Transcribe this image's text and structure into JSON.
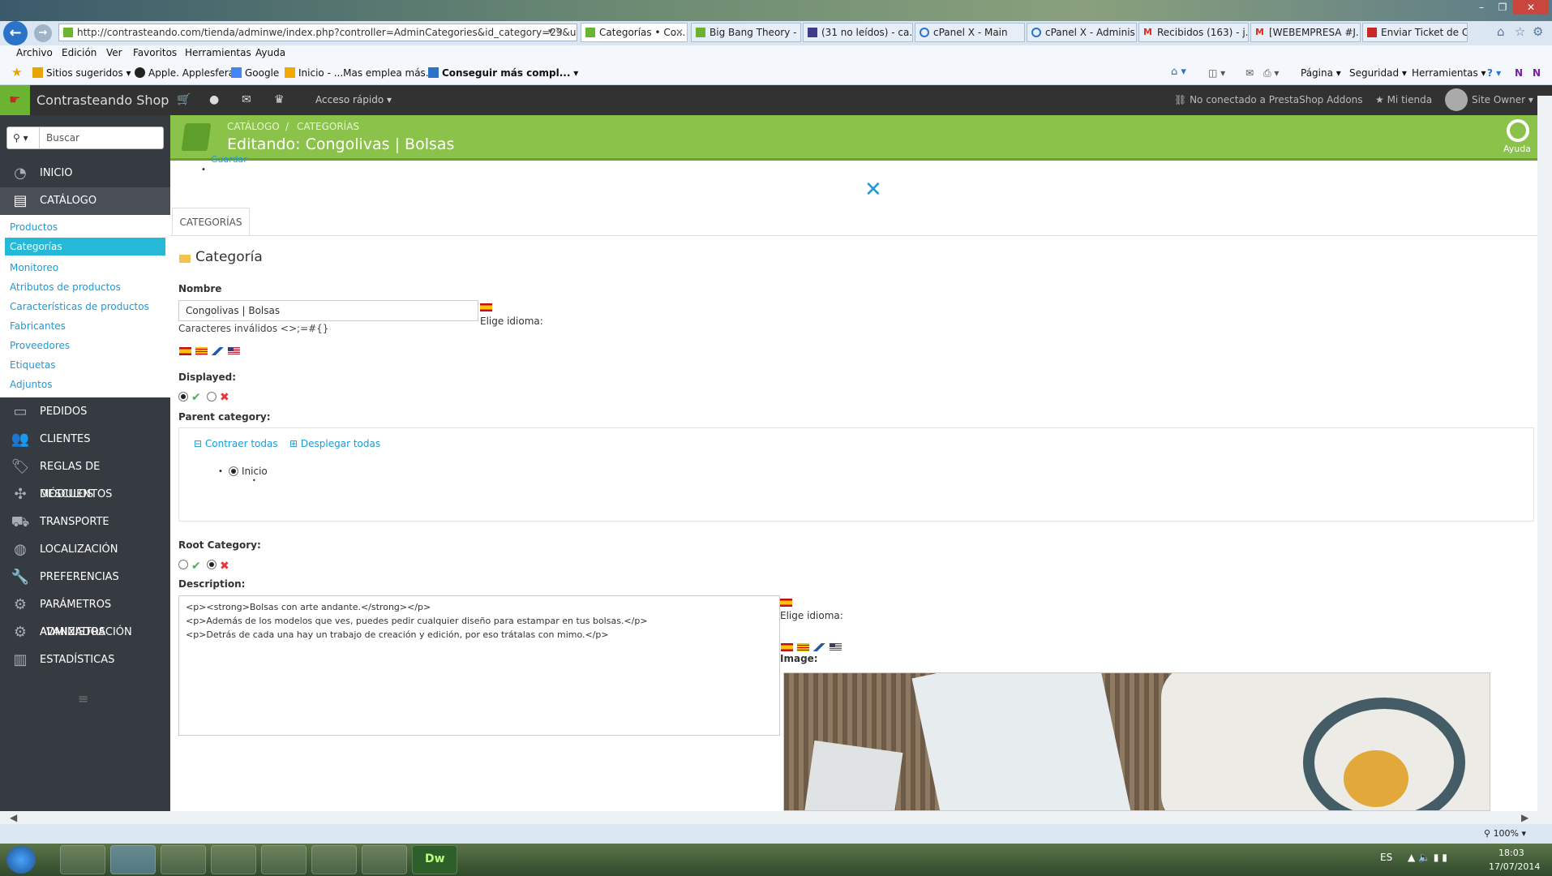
{
  "browser": {
    "url": "http://contrasteando.com/tienda/adminwe/index.php?controller=AdminCategories&id_category=23&updat",
    "tabs": [
      {
        "label": "Categorías • Co...",
        "active": true
      },
      {
        "label": "Big Bang Theory - ...",
        "active": false
      },
      {
        "label": "(31 no leídos) - ca...",
        "active": false
      },
      {
        "label": "cPanel X - Main",
        "active": false
      },
      {
        "label": "cPanel X - Adminis...",
        "active": false
      },
      {
        "label": "Recibidos (163) - j...",
        "active": false
      },
      {
        "label": "[WEBEMPRESA #J...",
        "active": false
      },
      {
        "label": "Enviar Ticket de C...",
        "active": false
      }
    ],
    "menu": [
      "Archivo",
      "Edición",
      "Ver",
      "Favoritos",
      "Herramientas",
      "Ayuda"
    ],
    "favorites": [
      "Sitios sugeridos ▾",
      "Apple. Applesfera",
      "Google",
      "Inicio - ...Mas emplea más...",
      "Conseguir más compl..."
    ],
    "right_tools": [
      "Página ▾",
      "Seguridad ▾",
      "Herramientas ▾"
    ],
    "zoom": "100%"
  },
  "header": {
    "shop_name": "Contrasteando Shop",
    "quick_access": "Acceso rápido",
    "addons": "No conectado a PrestaShop Addons",
    "my_shop": "Mi tienda",
    "user": "Site Owner"
  },
  "sidebar": {
    "search_placeholder": "Buscar",
    "items": [
      {
        "label": "INICIO",
        "icon": "dashboard-icon"
      },
      {
        "label": "CATÁLOGO",
        "icon": "book-icon"
      },
      {
        "label": "PEDIDOS",
        "icon": "credit-card-icon"
      },
      {
        "label": "CLIENTES",
        "icon": "users-icon"
      },
      {
        "label": "REGLAS DE DESCUENTOS",
        "icon": "tags-icon"
      },
      {
        "label": "MÓDULOS",
        "icon": "puzzle-icon"
      },
      {
        "label": "TRANSPORTE",
        "icon": "truck-icon"
      },
      {
        "label": "LOCALIZACIÓN",
        "icon": "globe-icon"
      },
      {
        "label": "PREFERENCIAS",
        "icon": "wrench-icon"
      },
      {
        "label": "PARÁMETROS AVANZADOS",
        "icon": "cogs-icon"
      },
      {
        "label": "ADMINISTRACIÓN",
        "icon": "gear-icon"
      },
      {
        "label": "ESTADÍSTICAS",
        "icon": "chart-icon"
      }
    ],
    "catalog_sub": [
      "Productos",
      "Categorías",
      "Monitoreo",
      "Atributos de productos",
      "Características de productos",
      "Fabricantes",
      "Proveedores",
      "Etiquetas",
      "Adjuntos"
    ]
  },
  "page": {
    "breadcrumb_1": "CATÁLOGO",
    "breadcrumb_2": "CATEGORÍAS",
    "title": "Editando: Congolivas | Bolsas",
    "help": "Ayuda",
    "overlap_text": "Guardar",
    "tab": "CATEGORÍAS",
    "panel_title": "Categoría"
  },
  "form": {
    "name_label": "Nombre",
    "name_value": "Congolivas | Bolsas",
    "choose_lang": "Elige idioma:",
    "invalid_chars": "Caracteres inválidos <>;=#{}",
    "displayed_label": "Displayed:",
    "parent_label": "Parent category:",
    "collapse_all": "Contraer todas",
    "expand_all": "Desplegar todas",
    "tree_root": "Inicio",
    "root_label": "Root Category:",
    "desc_label": "Description:",
    "desc_value": "<p><strong>Bolsas con arte andante.</strong></p>\n<p>Además de los modelos que ves, puedes pedir cualquier diseño para estampar en tus bolsas.</p>\n<p>Detrás de cada una hay un trabajo de creación y edición, por eso trátalas con mimo.</p>",
    "image_label": "Image:"
  },
  "taskbar": {
    "lang": "ES",
    "time": "18:03",
    "date": "17/07/2014"
  },
  "colors": {
    "green": "#8bc34a",
    "sidebar": "#363a41",
    "link": "#1a9bd8"
  }
}
